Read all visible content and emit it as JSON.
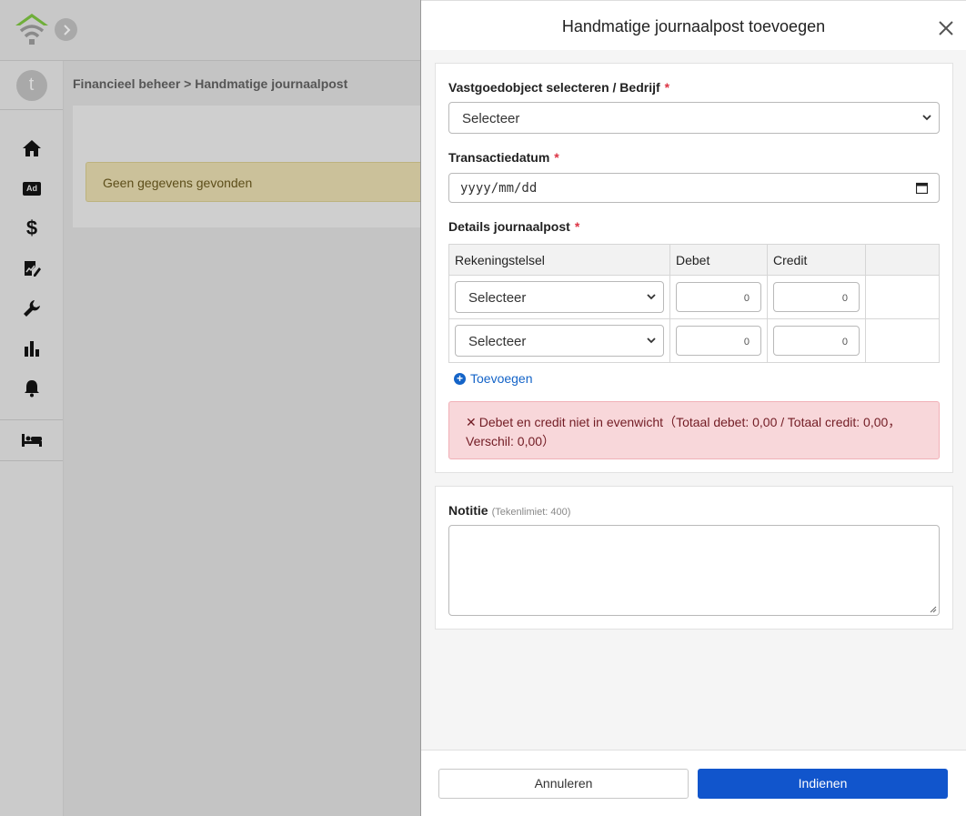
{
  "app": {
    "avatar_letter": "t",
    "breadcrumb": "Financieel beheer > Handmatige journaalpost",
    "empty_message": "Geen gegevens gevonden",
    "nav_icons": [
      "home-icon",
      "ad-icon",
      "dollar-icon",
      "report-icon",
      "wrench-icon",
      "bar-chart-icon",
      "bell-icon",
      "bed-icon"
    ],
    "ad_icon_text": "Ad",
    "dollar_icon_text": "$"
  },
  "modal": {
    "title": "Handmatige journaalpost toevoegen",
    "property": {
      "label": "Vastgoedobject selecteren / Bedrijf",
      "value": "Selecteer"
    },
    "date": {
      "label": "Transactiedatum",
      "placeholder": "yyyy/mm/dd"
    },
    "details": {
      "label": "Details journaalpost",
      "columns": [
        "Rekeningstelsel",
        "Debet",
        "Credit",
        ""
      ],
      "rows": [
        {
          "account": "Selecteer",
          "debit": "0",
          "credit": "0"
        },
        {
          "account": "Selecteer",
          "debit": "0",
          "credit": "0"
        }
      ]
    },
    "add_label": "Toevoegen",
    "error_text": "Debet en credit niet in evenwicht（Totaal debet: 0,00 / Totaal credit: 0,00， Verschil: 0,00）",
    "note": {
      "label": "Notitie",
      "hint": "(Tekenlimiet: 400)"
    },
    "cancel_label": "Annuleren",
    "submit_label": "Indienen"
  },
  "colors": {
    "primary": "#1155cc",
    "danger_bg": "#f8d7da",
    "required": "#dc3545"
  }
}
